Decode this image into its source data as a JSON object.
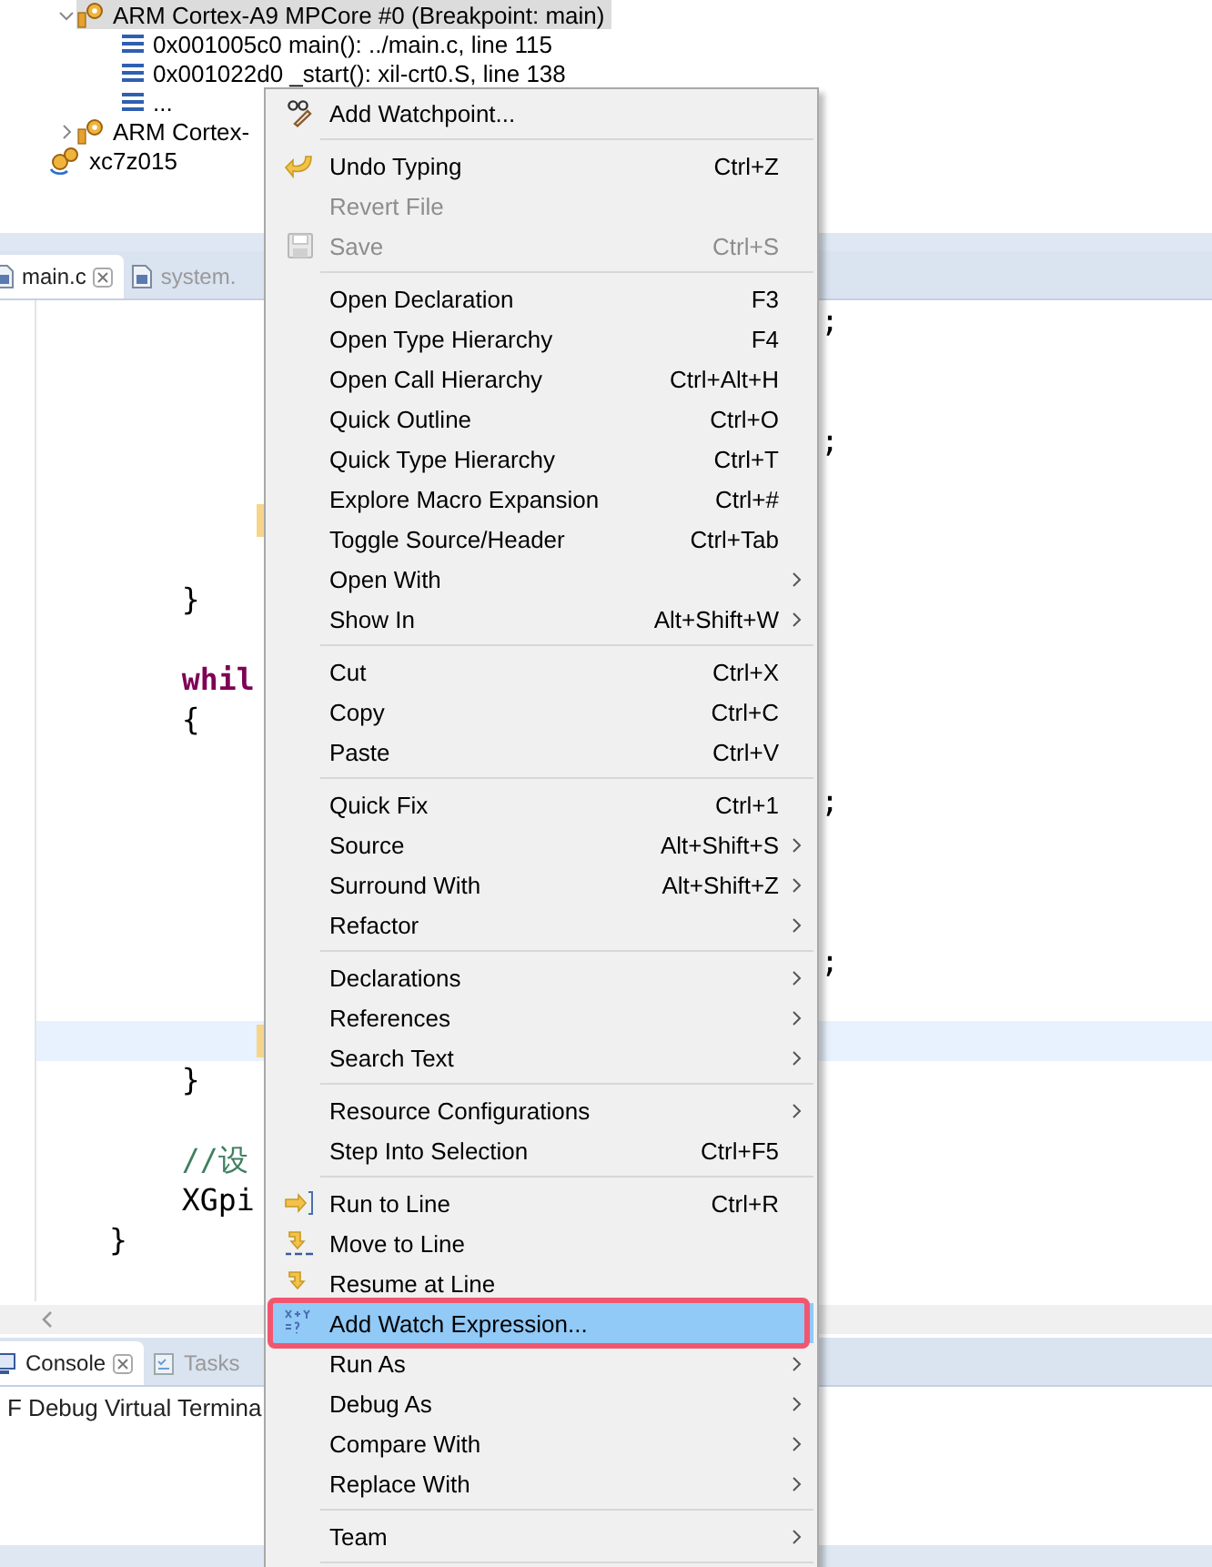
{
  "debug_tree": [
    {
      "kind": "core",
      "label": "ARM Cortex-A9 MPCore #0 (Breakpoint: main)",
      "expanded": true,
      "selected": true,
      "children": [
        {
          "kind": "frame",
          "label": "0x001005c0 main(): ../main.c, line 115",
          "selected": false
        },
        {
          "kind": "frame",
          "label": "0x001022d0 _start(): xil-crt0.S, line 138",
          "selected": false
        },
        {
          "kind": "frame",
          "label": "...",
          "selected": false
        }
      ]
    },
    {
      "kind": "core",
      "label": "ARM Cortex-",
      "expanded": false,
      "selected": false
    },
    {
      "kind": "target",
      "label": "xc7z015",
      "selected": false
    }
  ],
  "editor": {
    "tabs": [
      {
        "label": "main.c",
        "selected": true,
        "closable": true
      },
      {
        "label": "system.",
        "selected": false,
        "closable": false
      }
    ],
    "lines": [
      {
        "kind": "blank",
        "tail": ";"
      },
      {
        "kind": "blank"
      },
      {
        "kind": "blank"
      },
      {
        "kind": "blank",
        "tail": ";"
      },
      {
        "kind": "blank"
      },
      {
        "kind": "blank",
        "marked": true
      },
      {
        "kind": "blank"
      },
      {
        "kind": "plain",
        "text": "        }"
      },
      {
        "kind": "blank"
      },
      {
        "kind": "keyword",
        "text": "        whil"
      },
      {
        "kind": "plain",
        "text": "        {"
      },
      {
        "kind": "blank"
      },
      {
        "kind": "blank",
        "tail": ";"
      },
      {
        "kind": "blank"
      },
      {
        "kind": "blank"
      },
      {
        "kind": "blank"
      },
      {
        "kind": "blank",
        "tail": ";"
      },
      {
        "kind": "blank"
      },
      {
        "kind": "blank",
        "marked": true,
        "current": true
      },
      {
        "kind": "plain",
        "text": "        }"
      },
      {
        "kind": "blank"
      },
      {
        "kind": "comment",
        "text": "        //设"
      },
      {
        "kind": "plain",
        "text": "        XGpi"
      },
      {
        "kind": "plain",
        "text": "    }"
      },
      {
        "kind": "blank"
      }
    ]
  },
  "console": {
    "tabs": [
      {
        "label": "Console",
        "selected": true,
        "closable": true
      },
      {
        "label": "Tasks",
        "selected": false,
        "closable": false
      }
    ],
    "text": "F Debug Virtual Termina"
  },
  "context_menu": [
    {
      "kind": "item",
      "label": "Add Watchpoint...",
      "disabled": false,
      "selected": false,
      "submenu": false
    },
    {
      "kind": "separator"
    },
    {
      "kind": "item",
      "label": "Undo Typing",
      "shortcut": "Ctrl+Z",
      "disabled": false,
      "selected": false,
      "submenu": false
    },
    {
      "kind": "item",
      "label": "Revert File",
      "disabled": true,
      "selected": false,
      "submenu": false
    },
    {
      "kind": "item",
      "label": "Save",
      "shortcut": "Ctrl+S",
      "disabled": true,
      "selected": false,
      "submenu": false
    },
    {
      "kind": "separator"
    },
    {
      "kind": "item",
      "label": "Open Declaration",
      "shortcut": "F3",
      "disabled": false,
      "selected": false,
      "submenu": false
    },
    {
      "kind": "item",
      "label": "Open Type Hierarchy",
      "shortcut": "F4",
      "disabled": false,
      "selected": false,
      "submenu": false
    },
    {
      "kind": "item",
      "label": "Open Call Hierarchy",
      "shortcut": "Ctrl+Alt+H",
      "disabled": false,
      "selected": false,
      "submenu": false
    },
    {
      "kind": "item",
      "label": "Quick Outline",
      "shortcut": "Ctrl+O",
      "disabled": false,
      "selected": false,
      "submenu": false
    },
    {
      "kind": "item",
      "label": "Quick Type Hierarchy",
      "shortcut": "Ctrl+T",
      "disabled": false,
      "selected": false,
      "submenu": false
    },
    {
      "kind": "item",
      "label": "Explore Macro Expansion",
      "shortcut": "Ctrl+#",
      "disabled": false,
      "selected": false,
      "submenu": false
    },
    {
      "kind": "item",
      "label": "Toggle Source/Header",
      "shortcut": "Ctrl+Tab",
      "disabled": false,
      "selected": false,
      "submenu": false
    },
    {
      "kind": "item",
      "label": "Open With",
      "disabled": false,
      "selected": false,
      "submenu": true
    },
    {
      "kind": "item",
      "label": "Show In",
      "shortcut": "Alt+Shift+W",
      "disabled": false,
      "selected": false,
      "submenu": true
    },
    {
      "kind": "separator"
    },
    {
      "kind": "item",
      "label": "Cut",
      "shortcut": "Ctrl+X",
      "disabled": false,
      "selected": false,
      "submenu": false
    },
    {
      "kind": "item",
      "label": "Copy",
      "shortcut": "Ctrl+C",
      "disabled": false,
      "selected": false,
      "submenu": false
    },
    {
      "kind": "item",
      "label": "Paste",
      "shortcut": "Ctrl+V",
      "disabled": false,
      "selected": false,
      "submenu": false
    },
    {
      "kind": "separator"
    },
    {
      "kind": "item",
      "label": "Quick Fix",
      "shortcut": "Ctrl+1",
      "disabled": false,
      "selected": false,
      "submenu": false
    },
    {
      "kind": "item",
      "label": "Source",
      "shortcut": "Alt+Shift+S",
      "disabled": false,
      "selected": false,
      "submenu": true
    },
    {
      "kind": "item",
      "label": "Surround With",
      "shortcut": "Alt+Shift+Z",
      "disabled": false,
      "selected": false,
      "submenu": true
    },
    {
      "kind": "item",
      "label": "Refactor",
      "disabled": false,
      "selected": false,
      "submenu": true
    },
    {
      "kind": "separator"
    },
    {
      "kind": "item",
      "label": "Declarations",
      "disabled": false,
      "selected": false,
      "submenu": true
    },
    {
      "kind": "item",
      "label": "References",
      "disabled": false,
      "selected": false,
      "submenu": true
    },
    {
      "kind": "item",
      "label": "Search Text",
      "disabled": false,
      "selected": false,
      "submenu": true
    },
    {
      "kind": "separator"
    },
    {
      "kind": "item",
      "label": "Resource Configurations",
      "disabled": false,
      "selected": false,
      "submenu": true
    },
    {
      "kind": "item",
      "label": "Step Into Selection",
      "shortcut": "Ctrl+F5",
      "disabled": false,
      "selected": false,
      "submenu": false
    },
    {
      "kind": "separator"
    },
    {
      "kind": "item",
      "label": "Run to Line",
      "shortcut": "Ctrl+R",
      "disabled": false,
      "selected": false,
      "submenu": false
    },
    {
      "kind": "item",
      "label": "Move to Line",
      "disabled": false,
      "selected": false,
      "submenu": false
    },
    {
      "kind": "item",
      "label": "Resume at Line",
      "disabled": false,
      "selected": false,
      "submenu": false
    },
    {
      "kind": "item",
      "label": "Add Watch Expression...",
      "disabled": false,
      "selected": true,
      "submenu": false
    },
    {
      "kind": "item",
      "label": "Run As",
      "disabled": false,
      "selected": false,
      "submenu": true
    },
    {
      "kind": "item",
      "label": "Debug As",
      "disabled": false,
      "selected": false,
      "submenu": true
    },
    {
      "kind": "item",
      "label": "Compare With",
      "disabled": false,
      "selected": false,
      "submenu": true
    },
    {
      "kind": "item",
      "label": "Replace With",
      "disabled": false,
      "selected": false,
      "submenu": true
    },
    {
      "kind": "separator"
    },
    {
      "kind": "item",
      "label": "Team",
      "disabled": false,
      "selected": false,
      "submenu": true
    },
    {
      "kind": "separator"
    }
  ]
}
